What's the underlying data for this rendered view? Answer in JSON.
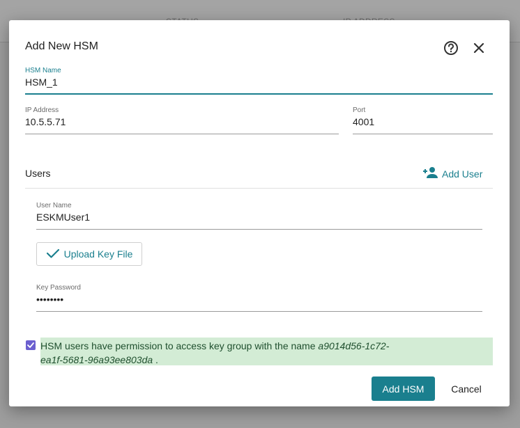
{
  "background": {
    "col_status": "STATUS",
    "col_ip": "IP ADDRESS"
  },
  "dialog": {
    "title": "Add New HSM",
    "help_icon": "help-circle-icon",
    "close_icon": "close-icon"
  },
  "form": {
    "hsm_name": {
      "label": "HSM Name",
      "value": "HSM_1"
    },
    "ip_address": {
      "label": "IP Address",
      "value": "10.5.5.71"
    },
    "port": {
      "label": "Port",
      "value": "4001"
    }
  },
  "users": {
    "label": "Users",
    "add_user_label": "Add User",
    "add_user_icon": "person-add-icon",
    "user_name": {
      "label": "User Name",
      "value": "ESKMUser1"
    },
    "upload_key_label": "Upload Key File",
    "upload_icon": "check-icon",
    "key_password": {
      "label": "Key Password",
      "value": "••••••••"
    }
  },
  "permission": {
    "checked": true,
    "text": "HSM users have permission to access key group with the name ",
    "group_line1": "a9014d56-1c72-",
    "group_line2": "ea1f-5681-96a93ee803da",
    "suffix": " ."
  },
  "actions": {
    "add_hsm_label": "Add HSM",
    "cancel_label": "Cancel"
  },
  "colors": {
    "accent": "#1a7f8e",
    "checkbox": "#6b5fcf",
    "success_bg": "#d3ecd5"
  }
}
